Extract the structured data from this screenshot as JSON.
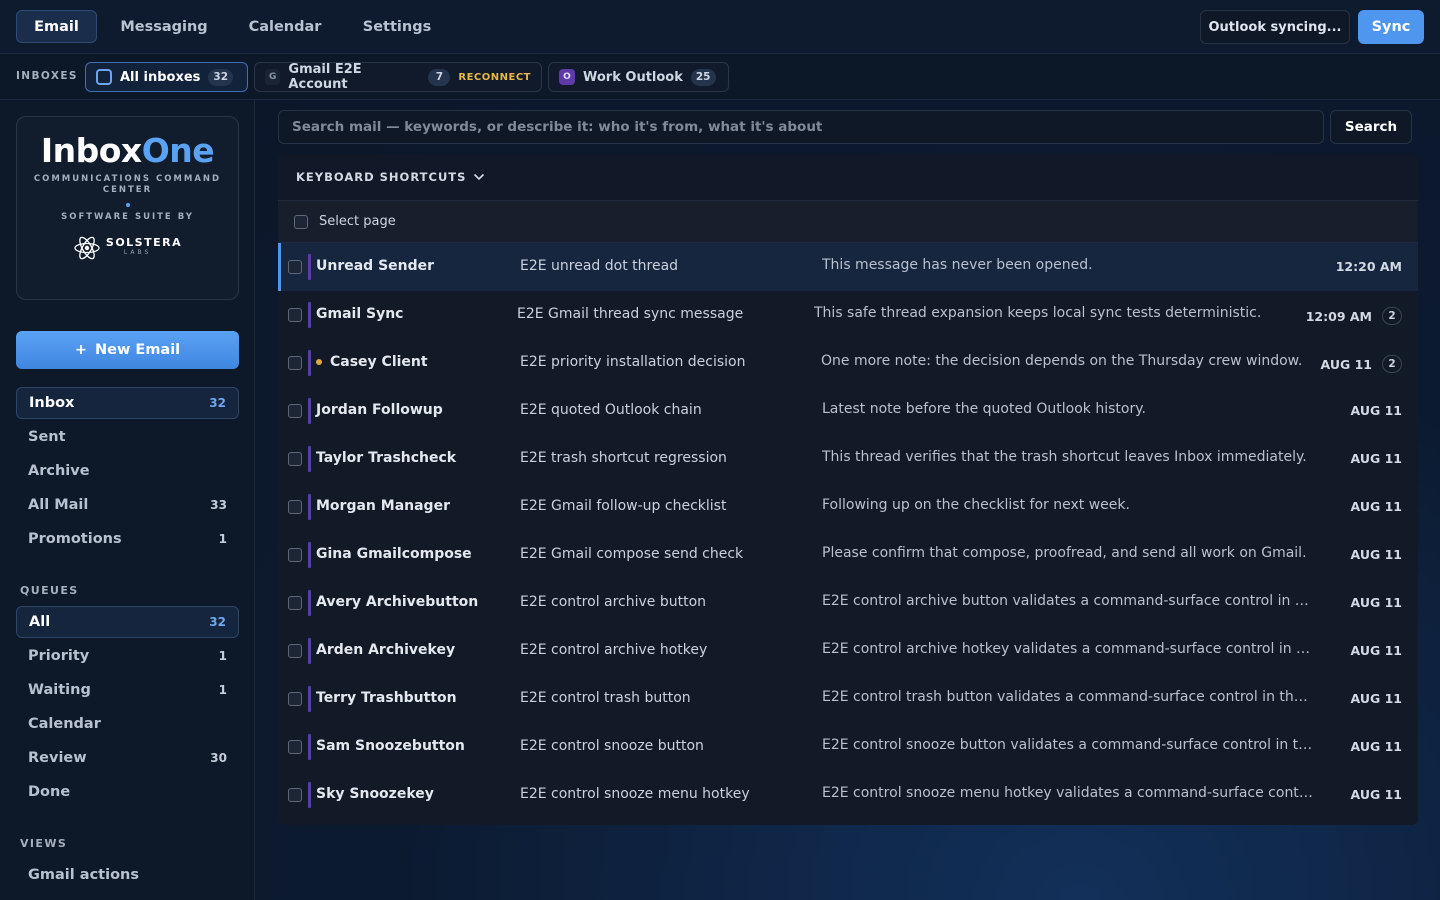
{
  "nav": {
    "tabs": [
      {
        "label": "Email",
        "active": true
      },
      {
        "label": "Messaging",
        "active": false
      },
      {
        "label": "Calendar",
        "active": false
      },
      {
        "label": "Settings",
        "active": false
      }
    ],
    "sync_status": "Outlook syncing...",
    "sync_label": "Sync"
  },
  "inboxes": {
    "label": "INBOXES",
    "all": {
      "label": "All inboxes",
      "count": "32"
    },
    "gmail": {
      "letter": "G",
      "label": "Gmail E2E Account",
      "count": "7",
      "action": "RECONNECT"
    },
    "outlook": {
      "letter": "O",
      "label": "Work Outlook",
      "count": "25"
    }
  },
  "brand": {
    "name_main": "Inbox",
    "name_accent": "One",
    "tagline": "COMMUNICATIONS COMMAND CENTER",
    "suite": "SOFTWARE SUITE BY",
    "company": "SOLSTERA",
    "company_sub": "LABS"
  },
  "sidebar": {
    "new_email": "New Email",
    "new_email_icon": "+",
    "folders": [
      {
        "label": "Inbox",
        "count": "32",
        "active": true
      },
      {
        "label": "Sent",
        "count": ""
      },
      {
        "label": "Archive",
        "count": ""
      },
      {
        "label": "All Mail",
        "count": "33"
      },
      {
        "label": "Promotions",
        "count": "1"
      }
    ],
    "queues_header": "QUEUES",
    "queues": [
      {
        "label": "All",
        "count": "32",
        "active": true
      },
      {
        "label": "Priority",
        "count": "1"
      },
      {
        "label": "Waiting",
        "count": "1"
      },
      {
        "label": "Calendar",
        "count": ""
      },
      {
        "label": "Review",
        "count": "30"
      },
      {
        "label": "Done",
        "count": ""
      }
    ],
    "views_header": "VIEWS",
    "views": [
      {
        "label": "Gmail actions"
      }
    ]
  },
  "search": {
    "placeholder": "Search mail — keywords, or describe it: who it's from, what it's about",
    "button": "Search"
  },
  "mail": {
    "shortcuts_label": "KEYBOARD SHORTCUTS",
    "select_page": "Select page",
    "rows": [
      {
        "sender": "Unread Sender",
        "subject": "E2E unread dot thread",
        "preview": "This message has never been opened.",
        "time": "12:20 AM",
        "count": "",
        "selected": true
      },
      {
        "sender": "Gmail Sync",
        "subject": "E2E Gmail thread sync message",
        "preview": "This safe thread expansion keeps local sync tests deterministic.",
        "time": "12:09 AM",
        "count": "2"
      },
      {
        "sender": "Casey Client",
        "subject": "E2E priority installation decision",
        "preview": "One more note: the decision depends on the Thursday crew window.",
        "time": "AUG 11",
        "count": "2",
        "priority": true
      },
      {
        "sender": "Jordan Followup",
        "subject": "E2E quoted Outlook chain",
        "preview": "Latest note before the quoted Outlook history.",
        "time": "AUG 11",
        "count": ""
      },
      {
        "sender": "Taylor Trashcheck",
        "subject": "E2E trash shortcut regression",
        "preview": "This thread verifies that the trash shortcut leaves Inbox immediately.",
        "time": "AUG 11",
        "count": ""
      },
      {
        "sender": "Morgan Manager",
        "subject": "E2E Gmail follow-up checklist",
        "preview": "Following up on the checklist for next week.",
        "time": "AUG 11",
        "count": ""
      },
      {
        "sender": "Gina Gmailcompose",
        "subject": "E2E Gmail compose send check",
        "preview": "Please confirm that compose, proofread, and send all work on Gmail.",
        "time": "AUG 11",
        "count": ""
      },
      {
        "sender": "Avery Archivebutton",
        "subject": "E2E control archive button",
        "preview": "E2E control archive button validates a command-surface control in the...",
        "time": "AUG 11",
        "count": ""
      },
      {
        "sender": "Arden Archivekey",
        "subject": "E2E control archive hotkey",
        "preview": "E2E control archive hotkey validates a command-surface control in th...",
        "time": "AUG 11",
        "count": ""
      },
      {
        "sender": "Terry Trashbutton",
        "subject": "E2E control trash button",
        "preview": "E2E control trash button validates a command-surface control in the s...",
        "time": "AUG 11",
        "count": ""
      },
      {
        "sender": "Sam Snoozebutton",
        "subject": "E2E control snooze button",
        "preview": "E2E control snooze button validates a command-surface control in the...",
        "time": "AUG 11",
        "count": ""
      },
      {
        "sender": "Sky Snoozekey",
        "subject": "E2E control snooze menu hotkey",
        "preview": "E2E control snooze menu hotkey validates a command-surface control...",
        "time": "AUG 11",
        "count": ""
      }
    ]
  }
}
